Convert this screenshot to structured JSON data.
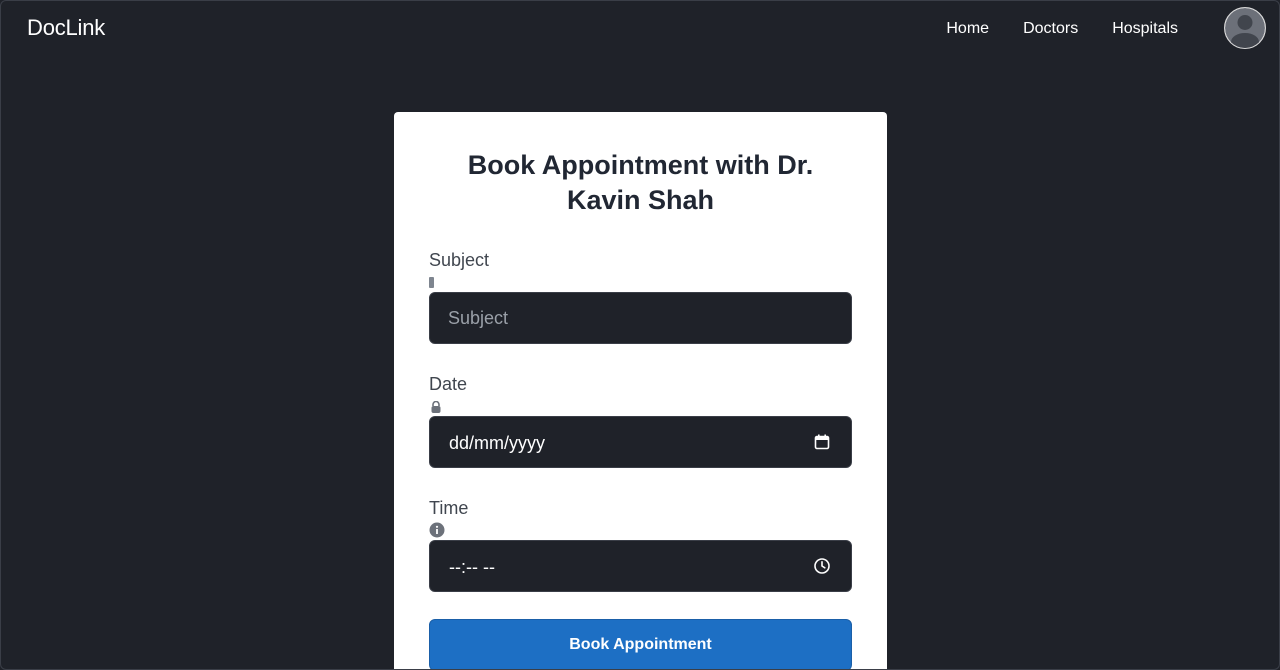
{
  "navbar": {
    "brand": "DocLink",
    "links": [
      {
        "label": "Home"
      },
      {
        "label": "Doctors"
      },
      {
        "label": "Hospitals"
      }
    ],
    "avatar_icon": "user-avatar-icon"
  },
  "form": {
    "title": "Book Appointment with Dr. Kavin Shah",
    "subject": {
      "label": "Subject",
      "placeholder": "Subject",
      "value": ""
    },
    "date": {
      "label": "Date",
      "value": "dd/mm/yyyy",
      "icon": "calendar-icon"
    },
    "time": {
      "label": "Time",
      "value": "--:-- --",
      "icon": "clock-icon"
    },
    "submit_label": "Book Appointment"
  },
  "colors": {
    "background": "#1f2229",
    "card": "#ffffff",
    "input_bg": "#1f2229",
    "button": "#1d6fc4",
    "title_text": "#212733"
  }
}
